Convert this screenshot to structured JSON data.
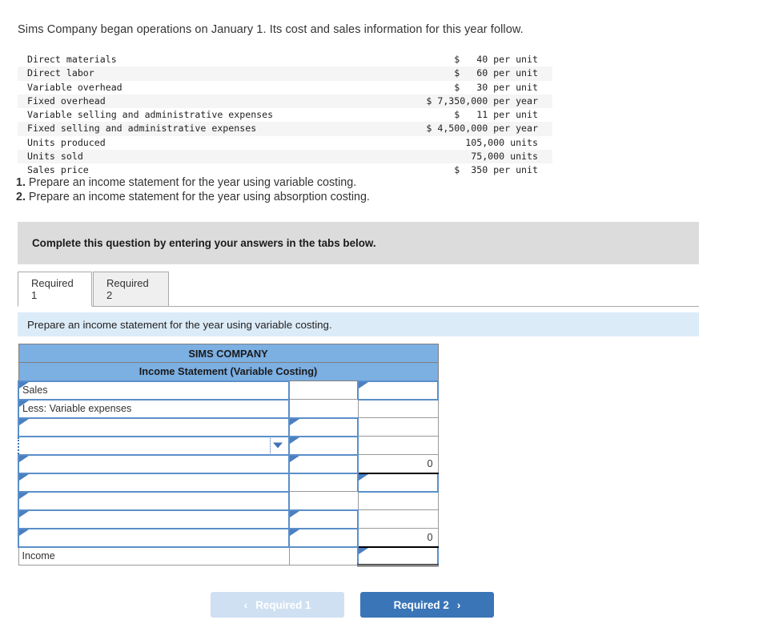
{
  "intro": "Sims Company began operations on January 1. Its cost and sales information for this year follow.",
  "facts": [
    {
      "label": "Direct materials",
      "value": "$   40 per unit"
    },
    {
      "label": "Direct labor",
      "value": "$   60 per unit"
    },
    {
      "label": "Variable overhead",
      "value": "$   30 per unit"
    },
    {
      "label": "Fixed overhead",
      "value": "$ 7,350,000 per year"
    },
    {
      "label": "Variable selling and administrative expenses",
      "value": "$   11 per unit"
    },
    {
      "label": "Fixed selling and administrative expenses",
      "value": "$ 4,500,000 per year"
    },
    {
      "label": "Units produced",
      "value": "105,000 units"
    },
    {
      "label": "Units sold",
      "value": "75,000 units"
    },
    {
      "label": "Sales price",
      "value": "$  350 per unit"
    }
  ],
  "requirements": [
    {
      "num": "1.",
      "text": " Prepare an income statement for the year using variable costing."
    },
    {
      "num": "2.",
      "text": " Prepare an income statement for the year using absorption costing."
    }
  ],
  "banner": {
    "text": "Complete this question by entering your answers in the tabs below."
  },
  "tabs": [
    {
      "label": "Required 1",
      "active": true
    },
    {
      "label": "Required 2",
      "active": false
    }
  ],
  "prompt": {
    "text": "Prepare an income statement for the year using variable costing."
  },
  "sheet": {
    "title": "SIMS COMPANY",
    "subtitle": "Income Statement (Variable Costing)",
    "rows": [
      {
        "label": "Sales",
        "mid": "",
        "right": ""
      },
      {
        "label": "Less: Variable expenses",
        "mid": "",
        "right": ""
      },
      {
        "label": "",
        "mid": "",
        "right": ""
      },
      {
        "label": "",
        "mid": "",
        "right": ""
      },
      {
        "label": "",
        "mid": "",
        "right": "0"
      },
      {
        "label": "",
        "mid": "",
        "right": ""
      },
      {
        "label": "",
        "mid": "",
        "right": ""
      },
      {
        "label": "",
        "mid": "",
        "right": ""
      },
      {
        "label": "",
        "mid": "",
        "right": "0"
      },
      {
        "label": "Income",
        "mid": "",
        "right": ""
      }
    ]
  },
  "nav": {
    "prev_label": "Required 1",
    "prev_chevron": "‹",
    "next_label": "Required 2",
    "next_chevron": "›"
  },
  "colors": {
    "header_blue": "#7cafe2",
    "prompt_blue": "#dcebf8",
    "banner_gray": "#dcdcdc",
    "button_blue": "#3a75b8",
    "button_disabled": "#cfe0f2",
    "cell_border_blue": "#5b8fc9"
  }
}
